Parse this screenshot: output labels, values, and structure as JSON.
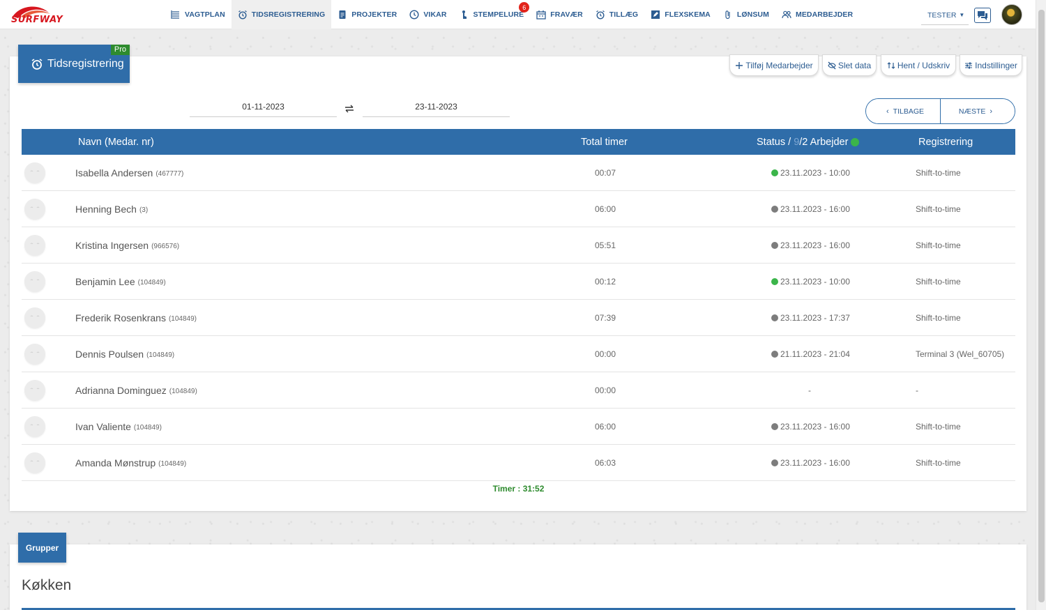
{
  "brand": {
    "logo_text": "SURFWAY",
    "logo_color": "#d7171f"
  },
  "nav": {
    "items": [
      {
        "label": "VAGTPLAN",
        "icon": "list-icon"
      },
      {
        "label": "TIDSREGISTRERING",
        "icon": "alarm-clock-icon",
        "active": true
      },
      {
        "label": "PROJEKTER",
        "icon": "document-icon"
      },
      {
        "label": "VIKAR",
        "icon": "clock-icon"
      },
      {
        "label": "STEMPELURE",
        "icon": "touch-icon",
        "badge": "6"
      },
      {
        "label": "FRAVÆR",
        "icon": "calendar-icon"
      },
      {
        "label": "TILLÆG",
        "icon": "alarm-clock-icon"
      },
      {
        "label": "FLEXSKEMA",
        "icon": "edit-icon"
      },
      {
        "label": "LØNSUM",
        "icon": "paperclip-icon"
      },
      {
        "label": "MEDARBEJDER",
        "icon": "users-icon"
      }
    ],
    "user": "TESTER"
  },
  "page": {
    "title": "Tidsregistrering",
    "pro_label": "Pro",
    "actions": {
      "add_employee": "Tilføj Medarbejder",
      "delete_data": "Slet data",
      "fetch_print": "Hent / Udskriv",
      "settings": "Indstillinger"
    },
    "date_from": "01-11-2023",
    "date_to": "23-11-2023",
    "back_label": "TILBAGE",
    "next_label": "NÆSTE"
  },
  "table": {
    "headers": {
      "name": "Navn (Medar. nr)",
      "total": "Total timer",
      "status_prefix": "Status /",
      "status_count_dim": "9",
      "status_suffix": "/2 Arbejder",
      "registration": "Registrering"
    },
    "rows": [
      {
        "name": "Isabella Andersen",
        "emp_no": "(467777)",
        "hours": "00:07",
        "status": "23.11.2023 - 10:00",
        "status_color": "#3bb54a",
        "registration": "Shift-to-time"
      },
      {
        "name": "Henning Bech",
        "emp_no": "(3)",
        "hours": "06:00",
        "status": "23.11.2023 - 16:00",
        "status_color": "#7d7d7d",
        "registration": "Shift-to-time"
      },
      {
        "name": "Kristina Ingersen",
        "emp_no": "(966576)",
        "hours": "05:51",
        "status": "23.11.2023 - 16:00",
        "status_color": "#7d7d7d",
        "registration": "Shift-to-time"
      },
      {
        "name": "Benjamin Lee",
        "emp_no": "(104849)",
        "hours": "00:12",
        "status": "23.11.2023 - 10:00",
        "status_color": "#3bb54a",
        "registration": "Shift-to-time"
      },
      {
        "name": "Frederik Rosenkrans",
        "emp_no": "(104849)",
        "hours": "07:39",
        "status": "23.11.2023 - 17:37",
        "status_color": "#7d7d7d",
        "registration": "Shift-to-time"
      },
      {
        "name": "Dennis Poulsen",
        "emp_no": "(104849)",
        "hours": "00:00",
        "status": "21.11.2023 - 21:04",
        "status_color": "#7d7d7d",
        "registration": "Terminal 3 (Wel_60705)"
      },
      {
        "name": "Adrianna Dominguez",
        "emp_no": "(104849)",
        "hours": "00:00",
        "status": "-",
        "status_color": "",
        "registration": "-"
      },
      {
        "name": "Ivan Valiente",
        "emp_no": "(104849)",
        "hours": "06:00",
        "status": "23.11.2023 - 16:00",
        "status_color": "#7d7d7d",
        "registration": "Shift-to-time"
      },
      {
        "name": "Amanda Mønstrup",
        "emp_no": "(104849)",
        "hours": "06:03",
        "status": "23.11.2023 - 16:00",
        "status_color": "#7d7d7d",
        "registration": "Shift-to-time"
      }
    ],
    "total_label": "Timer : 31:52"
  },
  "groups": {
    "tab_label": "Grupper",
    "first_group": "Køkken"
  },
  "colors": {
    "primary": "#2f6da9",
    "nav_text": "#2c5c91",
    "online": "#3bb54a",
    "pro": "#2e8b2e"
  }
}
